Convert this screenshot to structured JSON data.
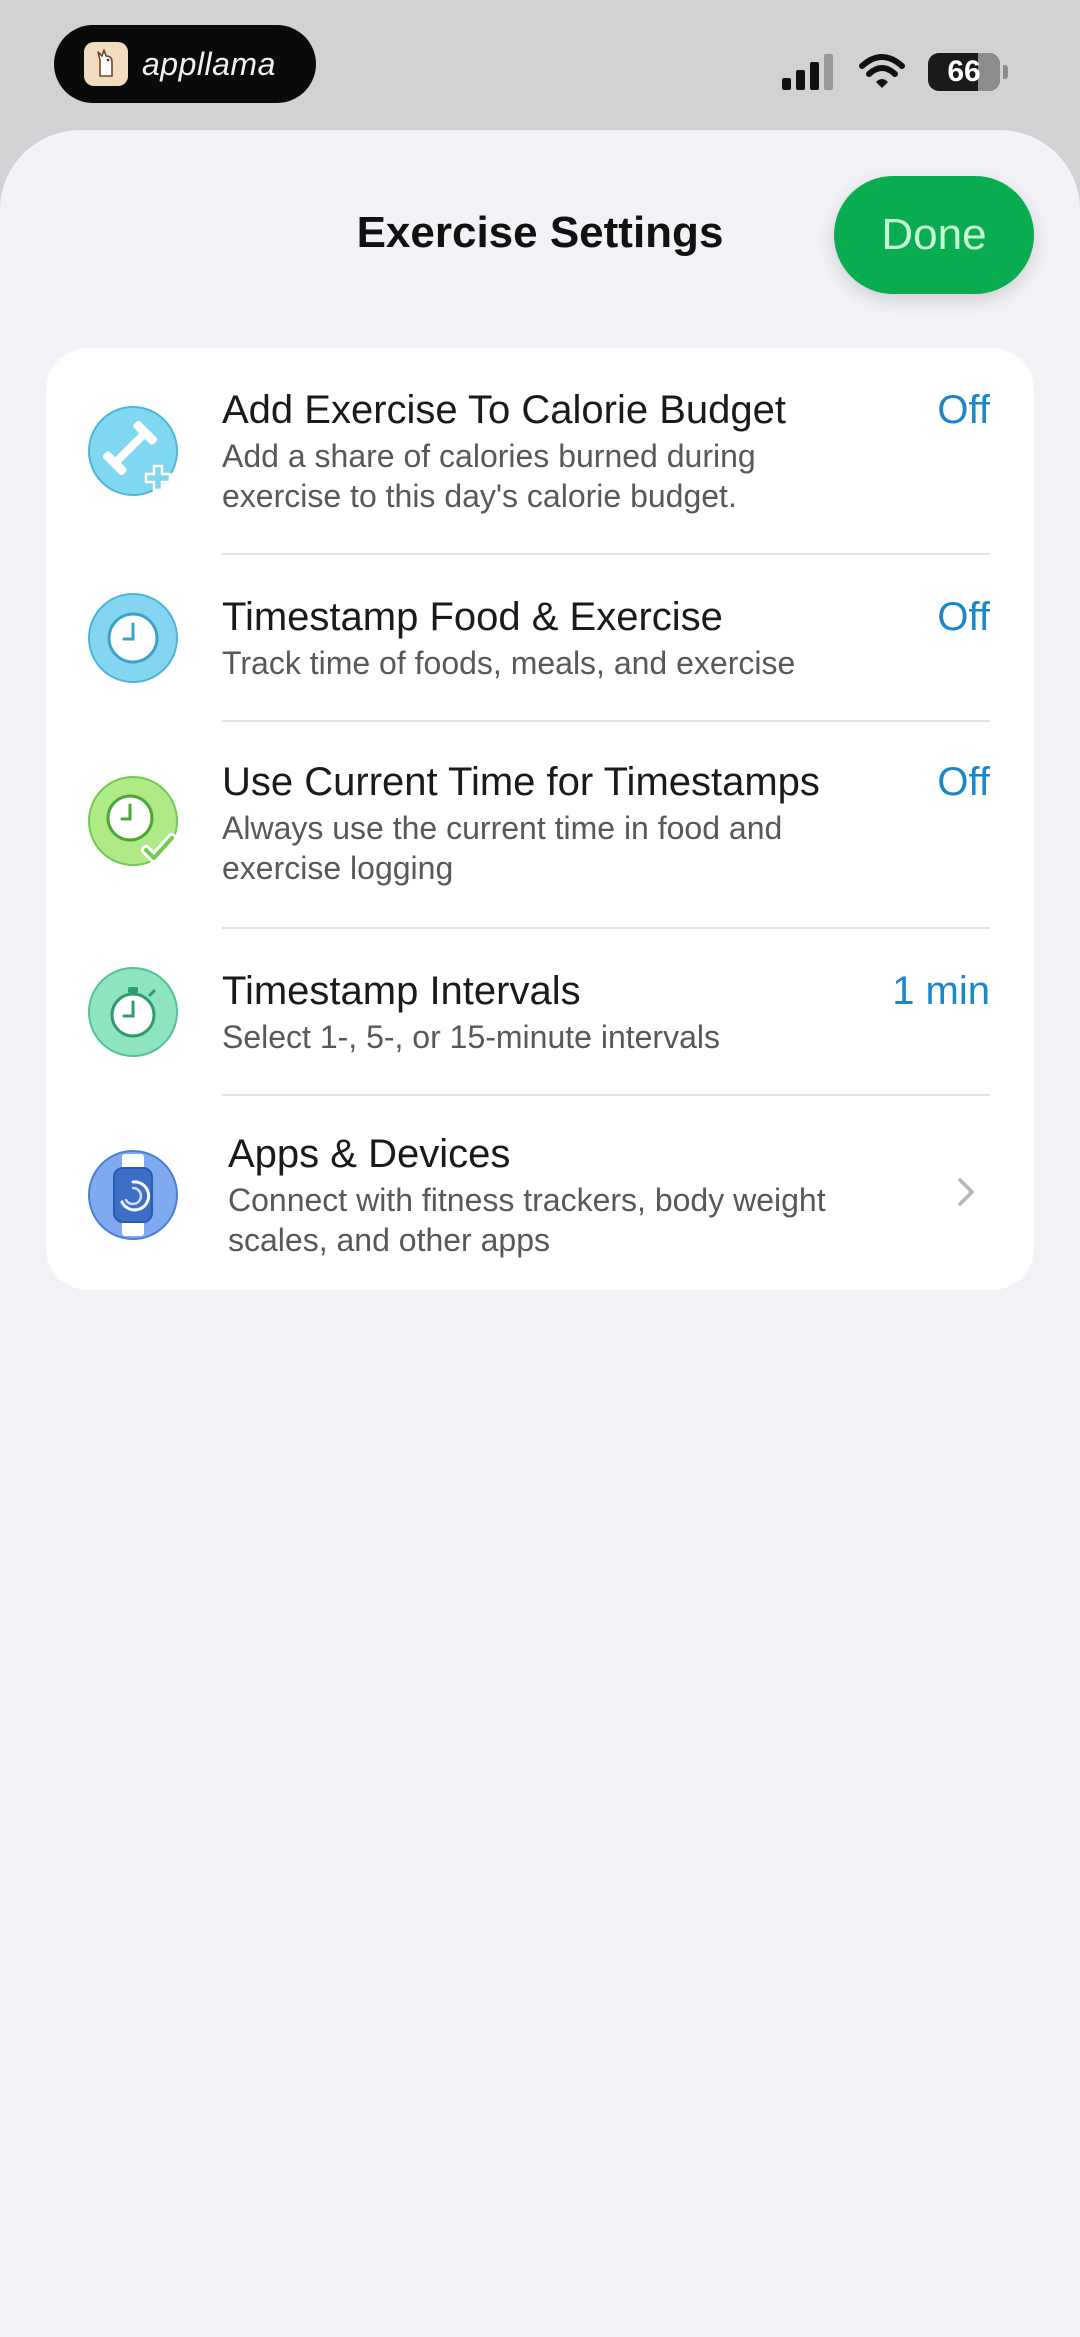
{
  "status_bar": {
    "app_name": "appllama",
    "battery_level": "66"
  },
  "sheet": {
    "title": "Exercise Settings",
    "done_label": "Done"
  },
  "settings": [
    {
      "title": "Add Exercise To Calorie Budget",
      "subtitle": "Add a share of calories burned during exercise to this day's calorie budget.",
      "value": "Off",
      "icon": "dumbbell-plus-icon"
    },
    {
      "title": "Timestamp Food & Exercise",
      "subtitle": "Track time of foods, meals, and exercise",
      "value": "Off",
      "icon": "clock-icon"
    },
    {
      "title": "Use Current Time for Timestamps",
      "subtitle": "Always use the current time in food and exercise logging",
      "value": "Off",
      "icon": "clock-check-icon"
    },
    {
      "title": "Timestamp Intervals",
      "subtitle": "Select 1-, 5-, or 15-minute intervals",
      "value": "1 min",
      "icon": "stopwatch-icon"
    },
    {
      "title": "Apps & Devices",
      "subtitle": "Connect with fitness trackers, body weight scales, and other apps",
      "icon": "smartwatch-icon"
    }
  ],
  "colors": {
    "accent_blue": "#1a87c9",
    "done_green": "#09ad4f",
    "sheet_bg": "#f2f2f7"
  }
}
